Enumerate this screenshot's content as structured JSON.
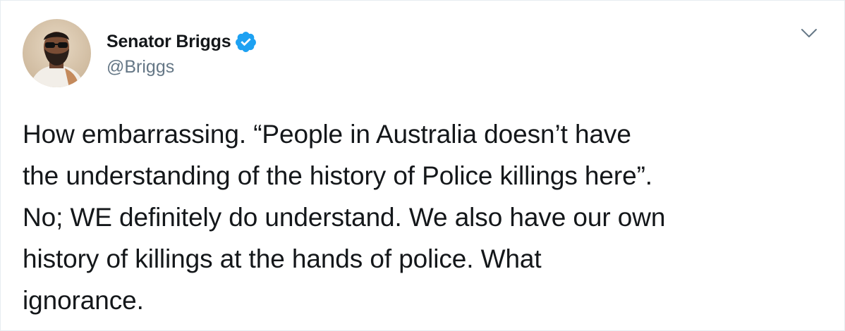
{
  "tweet": {
    "author": {
      "display_name": "Senator Briggs",
      "handle": "@Briggs",
      "verified": true,
      "verified_color": "#1da1f2"
    },
    "text": "How embarrassing. “People in Australia doesn’t have\nthe understanding of the history of Police killings here”.\nNo; WE definitely do understand. We also have our own\nhistory of killings at the hands of police. What\nignorance.",
    "menu_icon": "chevron-down-icon"
  },
  "colors": {
    "text": "#14171a",
    "secondary_text": "#657786",
    "border": "#e6ecf0",
    "accent": "#1da1f2"
  }
}
